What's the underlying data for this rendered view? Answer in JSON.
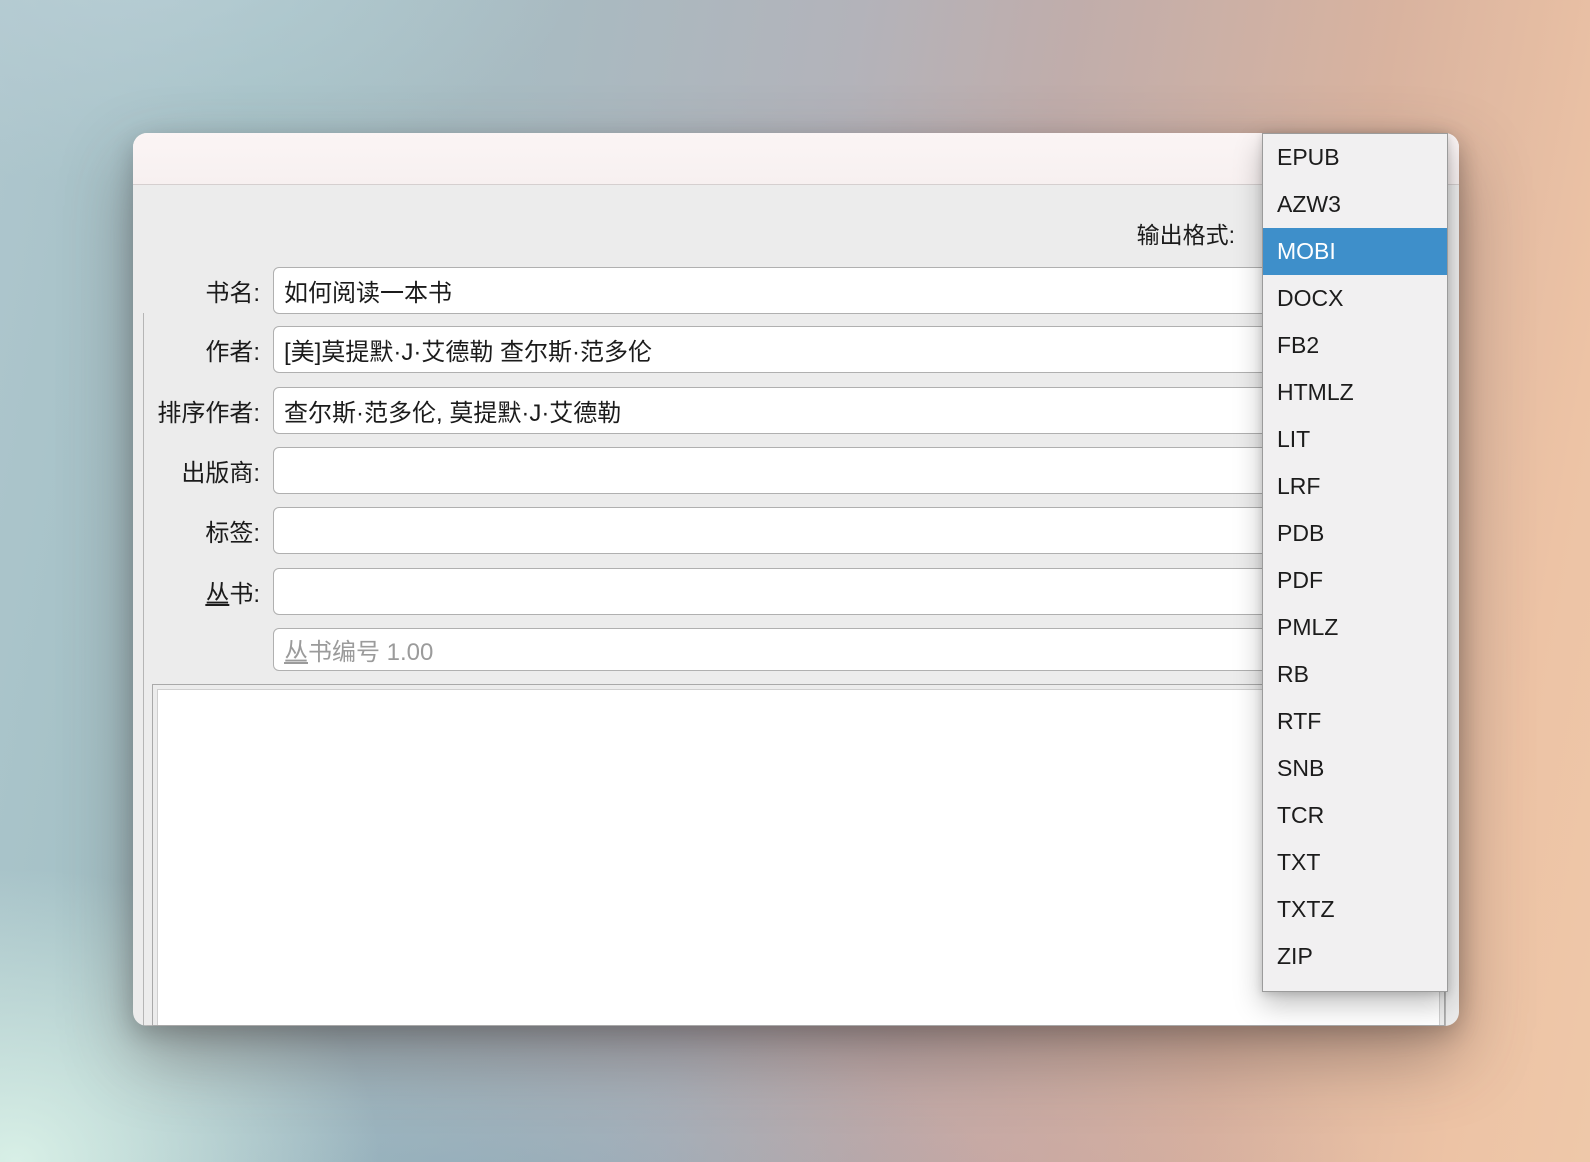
{
  "window": {
    "kind": "convert-dialog",
    "titlebar_text": ""
  },
  "form": {
    "output_format_label": "输出格式:",
    "fields": [
      {
        "label_mn": "",
        "label_rest": "书名:",
        "value": "如何阅读一本书"
      },
      {
        "label_mn": "",
        "label_rest": "作者:",
        "value": "[美]莫提默·J·艾德勒 查尔斯·范多伦"
      },
      {
        "label_mn": "",
        "label_rest": "排序作者:",
        "value": "查尔斯·范多伦, 莫提默·J·艾德勒"
      },
      {
        "label_mn": "",
        "label_rest": "出版商:",
        "value": ""
      },
      {
        "label_mn": "",
        "label_rest": "标签:",
        "value": ""
      },
      {
        "label_mn": "丛",
        "label_rest": "书:",
        "value": ""
      }
    ],
    "field_names": [
      "title",
      "authors",
      "author-sort",
      "publisher",
      "tags",
      "series"
    ],
    "series_index": {
      "placeholder_mn": "丛",
      "placeholder_rest": "书编号 1.00"
    },
    "comments_value": ""
  },
  "dropdown": {
    "name": "output-format-list",
    "items": [
      "EPUB",
      "AZW3",
      "MOBI",
      "DOCX",
      "FB2",
      "HTMLZ",
      "LIT",
      "LRF",
      "PDB",
      "PDF",
      "PMLZ",
      "RB",
      "RTF",
      "SNB",
      "TCR",
      "TXT",
      "TXTZ",
      "ZIP"
    ],
    "selected": "MOBI",
    "selected_index": 2,
    "highlight_color": "#3e8fca"
  }
}
